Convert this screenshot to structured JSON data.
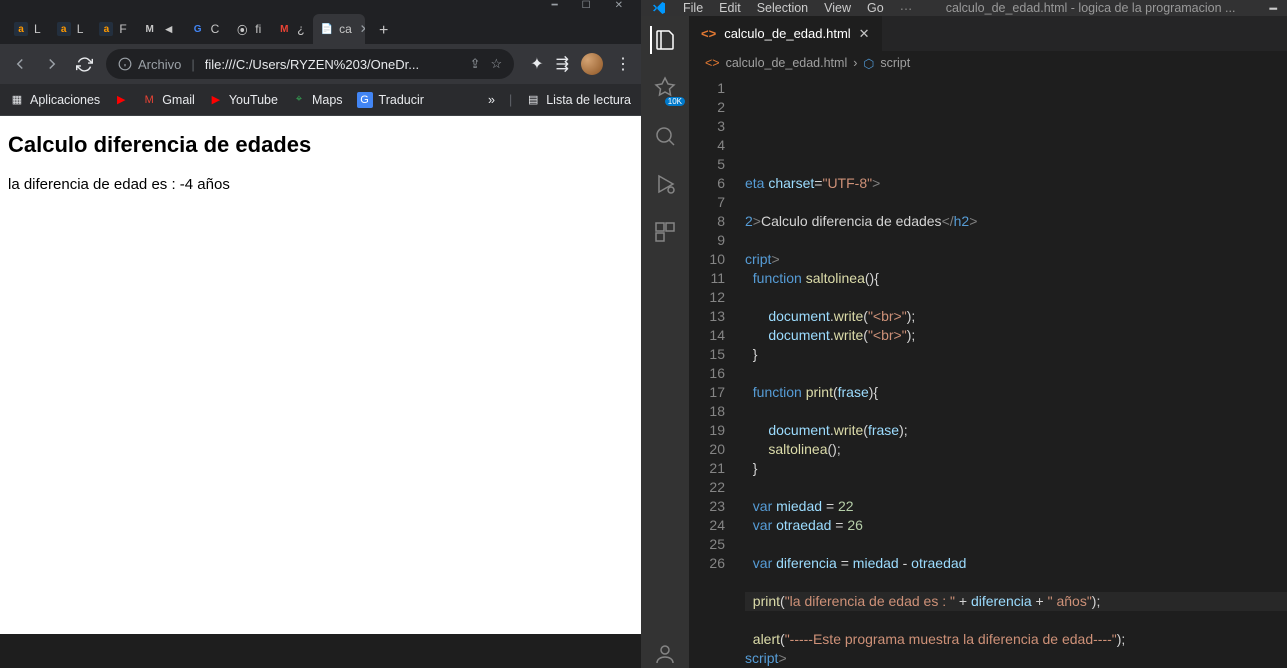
{
  "chrome": {
    "tabs": [
      {
        "fav": "a",
        "label": "L",
        "favClass": "orange"
      },
      {
        "fav": "a",
        "label": "L",
        "favClass": "orange"
      },
      {
        "fav": "a",
        "label": "F",
        "favClass": "orange"
      },
      {
        "fav": "M",
        "label": "◄",
        "favClass": ""
      },
      {
        "fav": "G",
        "label": "C",
        "favClass": ""
      },
      {
        "fav": "⦿",
        "label": "fi",
        "favClass": ""
      },
      {
        "fav": "M",
        "label": "¿",
        "favClass": ""
      },
      {
        "fav": "",
        "label": "ca",
        "favClass": "",
        "active": true
      }
    ],
    "omnibox": {
      "scheme_label": "Archivo",
      "url": "file:///C:/Users/RYZEN%203/OneDr..."
    },
    "bookmarks": {
      "apps": "Aplicaciones",
      "gmail": "Gmail",
      "youtube": "YouTube",
      "maps": "Maps",
      "traducir": "Traducir",
      "more": "»",
      "reading": "Lista de lectura"
    },
    "page": {
      "heading": "Calculo diferencia de edades",
      "body": "la diferencia de edad es : -4 años"
    }
  },
  "vscode": {
    "menu": [
      "File",
      "Edit",
      "Selection",
      "View",
      "Go"
    ],
    "title_file": "calculo_de_edad.html - logica de la programacion ...",
    "tab": "calculo_de_edad.html",
    "crumb_file": "calculo_de_edad.html",
    "crumb_symbol": "script",
    "badge": "10K",
    "line_numbers": [
      "1",
      "2",
      "3",
      "4",
      "5",
      "6",
      "7",
      "8",
      "9",
      "10",
      "11",
      "12",
      "13",
      "14",
      "15",
      "16",
      "17",
      "18",
      "19",
      "20",
      "21",
      "22",
      "23",
      "24",
      "25",
      "26"
    ],
    "code": {
      "l1": "eta",
      "l1_charset": "charset",
      "l1_val": "\"UTF-8\"",
      "l3_open": "Calculo diferencia de edades",
      "l5_cript": "cript",
      "l6_fn": "function",
      "l6_name": "saltolinea",
      "l8_doc": "document",
      "l8_write": "write",
      "l8_arg": "\"<br>\"",
      "l12_name": "print",
      "l12_param": "frase",
      "l14_arg": "frase",
      "l15_call": "saltolinea",
      "l18_var": "var",
      "l18_name": "miedad",
      "l18_val": "22",
      "l19_name": "otraedad",
      "l19_val": "26",
      "l21_name": "diferencia",
      "l21_expr_a": "miedad",
      "l21_expr_b": "otraedad",
      "l23_call": "print",
      "l23_s1": "\"la diferencia de edad es : \"",
      "l23_v": "diferencia",
      "l23_s2": "\" años\"",
      "l25_call": "alert",
      "l25_arg": "\"-----Este programa muestra la diferencia de edad----\"",
      "l26_close": "script"
    }
  }
}
